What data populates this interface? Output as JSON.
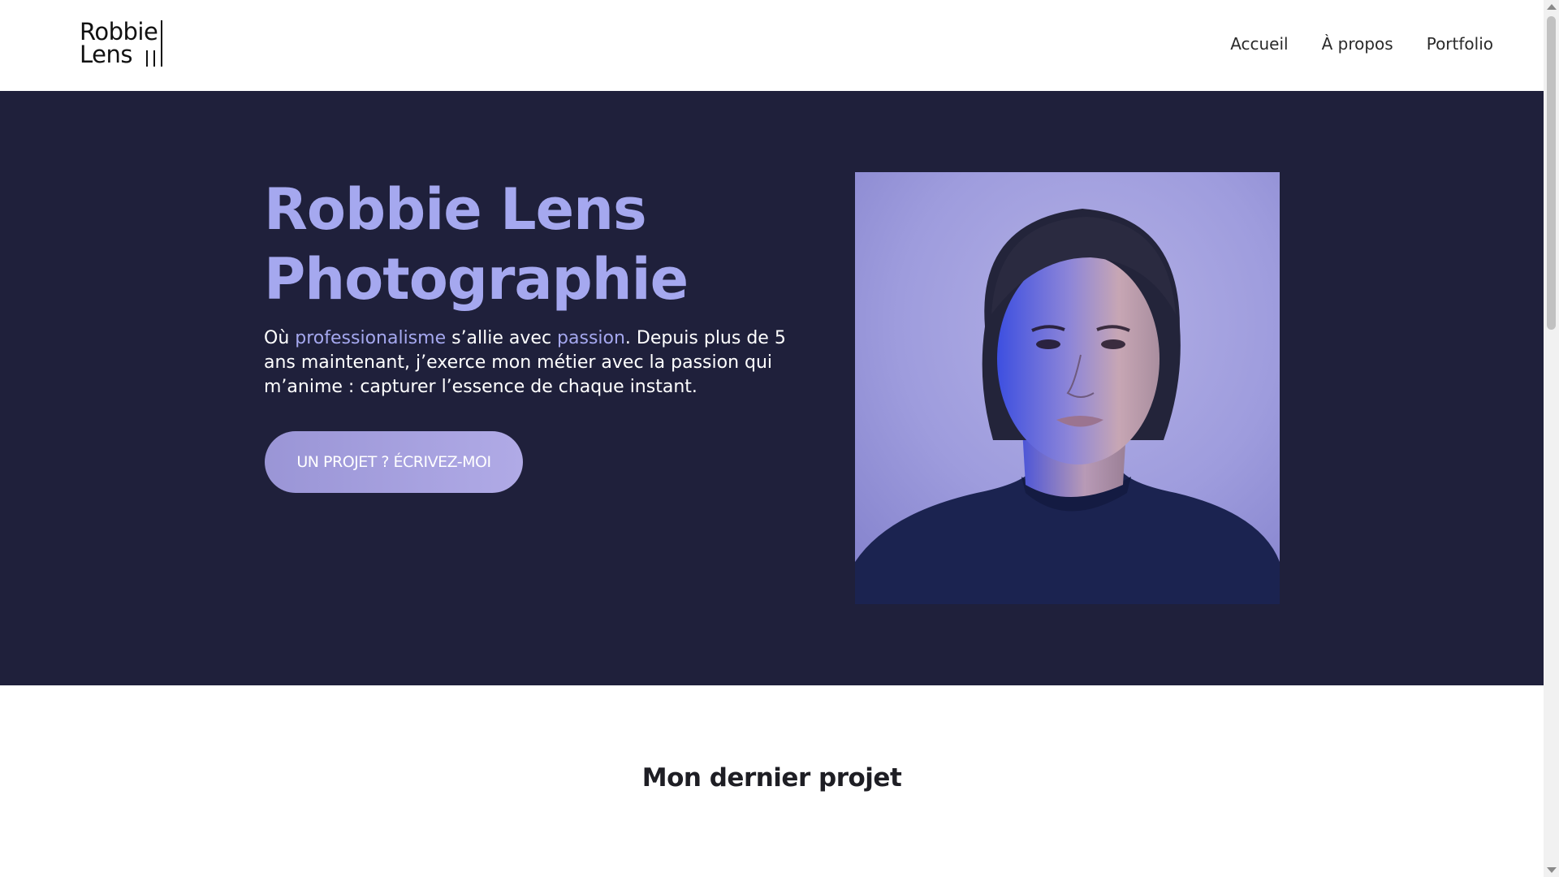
{
  "logo": {
    "line1": "Robbie",
    "line2": "Lens"
  },
  "nav": {
    "items": [
      {
        "label": "Accueil"
      },
      {
        "label": "À propos"
      },
      {
        "label": "Portfolio"
      }
    ]
  },
  "hero": {
    "title_line1": "Robbie Lens",
    "title_line2": "Photographie",
    "intro_part1": "Où ",
    "intro_highlight1": "professionalisme",
    "intro_part2": " s’allie avec ",
    "intro_highlight2": "passion",
    "intro_part3": ". Depuis plus de 5 ans maintenant, j’exerce mon métier avec la passion qui m’anime : capturer l’essence de chaque instant.",
    "cta_label": "UN PROJET ? ÉCRIVEZ-MOI"
  },
  "section": {
    "title": "Mon dernier projet"
  },
  "colors": {
    "hero_background": "#1f203b",
    "accent": "#a5a8ef",
    "cta_background": "#a39fdd"
  },
  "icons": {
    "scroll_up": "scroll-up-arrow-icon",
    "scroll_down": "scroll-down-arrow-icon"
  }
}
